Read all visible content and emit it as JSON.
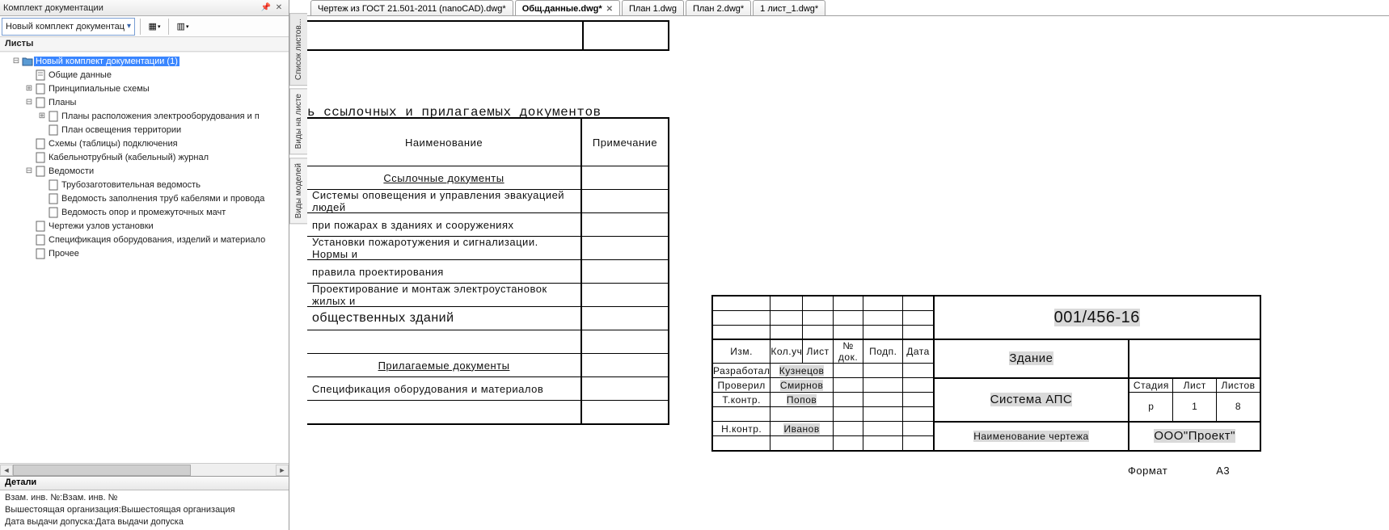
{
  "panel": {
    "title": "Комплект документации",
    "combo_label": "Новый комплект документац",
    "tree_caption": "Листы",
    "root": "Новый комплект документации (1)",
    "items": {
      "common": "Общие данные",
      "schemes": "Принципиальные схемы",
      "plans": "Планы",
      "plan_elec": "Планы расположения электрооборудования и п",
      "plan_light": "План освещения территории",
      "conn": "Схемы (таблицы) подключения",
      "cable": "Кабельнотрубный (кабельный) журнал",
      "vedom": "Ведомости",
      "v1": "Трубозаготовительная ведомость",
      "v2": "Ведомость заполнения труб кабелями и провода",
      "v3": "Ведомость опор и промежуточных мачт",
      "nodes": "Чертежи узлов установки",
      "spec": "Спецификация оборудования, изделий и материало",
      "other": "Прочее"
    }
  },
  "details": {
    "title": "Детали",
    "r1k": "Взам. инв. №:",
    "r1v": "Взам. инв. №",
    "r2k": "Вышестоящая организация:",
    "r2v": "Вышестоящая организация",
    "r3k": "Дата выдачи допуска:",
    "r3v": "Дата выдачи допуска"
  },
  "sidetabs": {
    "t1": "Список листов...",
    "t2": "Виды на листе",
    "t3": "Виды моделей"
  },
  "tabs": [
    {
      "label": "Чертеж из ГОСТ 21.501-2011 (nanoCAD).dwg*",
      "active": false,
      "close": false
    },
    {
      "label": "Общ.данные.dwg*",
      "active": true,
      "close": true
    },
    {
      "label": "План 1.dwg",
      "active": false,
      "close": false
    },
    {
      "label": "План 2.dwg*",
      "active": false,
      "close": false
    },
    {
      "label": "1 лист_1.dwg*",
      "active": false,
      "close": false
    }
  ],
  "ref": {
    "heading": "ь ссылочных и прилагаемых документов",
    "h_name": "Наименование",
    "h_note": "Примечание",
    "sub1": "Ссылочные документы",
    "r1": "Системы оповещения и управления эвакуацией людей",
    "r2": "при пожарах в зданиях и сооружениях",
    "r3": "Установки пожаротужения и сигнализации. Нормы и",
    "r4": "правила проектирования",
    "r5": "Проектирование и монтаж электроустановок жилых и",
    "r6": "общественных зданий",
    "sub2": "Прилагаемые документы",
    "r7": "Спецификация оборудования и материалов"
  },
  "stamp": {
    "code": "001/456-16",
    "building": "Здание",
    "h_izm": "Изм.",
    "h_kol": "Кол.уч",
    "h_list": "Лист",
    "h_doc": "№ док.",
    "h_sign": "Подп.",
    "h_date": "Дата",
    "role1": "Разработал",
    "name1": "Кузнецов",
    "role2": "Проверил",
    "name2": "Смирнов",
    "role3": "Т.контр.",
    "name3": "Попов",
    "role4": "Н.контр.",
    "name4": "Иванов",
    "system": "Система АПС",
    "dwgname": "Наименование чертежа",
    "h_stage": "Стадия",
    "h_sheet": "Лист",
    "h_sheets": "Листов",
    "v_stage": "р",
    "v_sheet": "1",
    "v_sheets": "8",
    "org": "ООО\"Проект\"",
    "fmt_l": "Формат",
    "fmt_v": "А3"
  }
}
